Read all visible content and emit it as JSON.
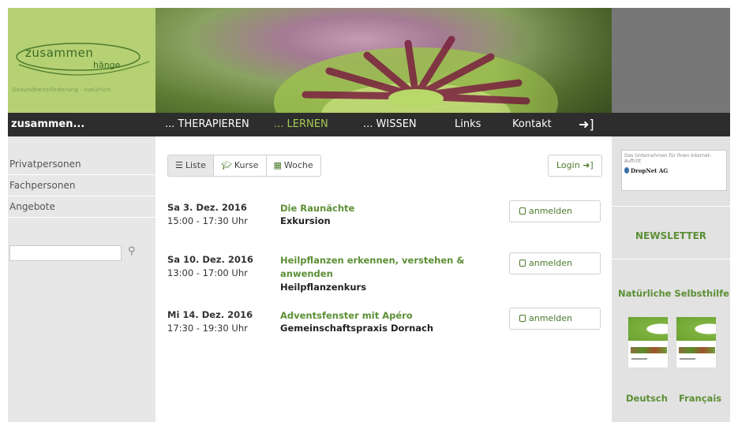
{
  "logo": {
    "word1": "zusammen",
    "word2": "hänge",
    "tagline": "Gesundheitsförderung · natürlich"
  },
  "nav": {
    "brand": "zusammen...",
    "items": [
      {
        "label": "... THERAPIEREN",
        "active": false
      },
      {
        "label": "... LERNEN",
        "active": true
      },
      {
        "label": "... WISSEN",
        "active": false
      },
      {
        "label": "Links",
        "active": false
      },
      {
        "label": "Kontakt",
        "active": false
      }
    ],
    "login_icon": "login-arrow-icon"
  },
  "sidebar": {
    "items": [
      {
        "label": "Privatpersonen"
      },
      {
        "label": "Fachpersonen"
      },
      {
        "label": "Angebote"
      }
    ],
    "search": {
      "placeholder": "",
      "value": ""
    }
  },
  "main": {
    "tabs": [
      {
        "label": "Liste",
        "icon": "list-icon",
        "active": true
      },
      {
        "label": "Kurse",
        "icon": "graduation-cap-icon",
        "active": false
      },
      {
        "label": "Woche",
        "icon": "calendar-icon",
        "active": false
      }
    ],
    "login_button": "Login",
    "events": [
      {
        "date": "Sa 3. Dez. 2016",
        "time": "15:00 - 17:30 Uhr",
        "title": "Die Raunächte",
        "subtitle": "Exkursion",
        "button": "anmelden"
      },
      {
        "date": "Sa 10. Dez. 2016",
        "time": "13:00 - 17:00 Uhr",
        "title": "Heilpflanzen erkennen, verstehen & anwenden",
        "subtitle": "Heilpflanzenkurs",
        "button": "anmelden"
      },
      {
        "date": "Mi 14. Dez. 2016",
        "time": "17:30 - 19:30 Uhr",
        "title": "Adventsfenster mit Apéro",
        "subtitle": "Gemeinschaftspraxis Dornach",
        "button": "anmelden"
      }
    ]
  },
  "right": {
    "sponsor_text": "Das Unternehmen für Ihren Internet-Auftritt",
    "sponsor_logo": "DropNet AG",
    "newsletter": "NEWSLETTER",
    "selbsthilfe": "Natürliche Selbsthilfe",
    "languages": [
      "Deutsch",
      "Français"
    ]
  },
  "colors": {
    "accent_green": "#5b8f35",
    "nav_bg": "#2d2d2d",
    "logo_bg": "#b5d173",
    "nav_active": "#a5cc55"
  }
}
